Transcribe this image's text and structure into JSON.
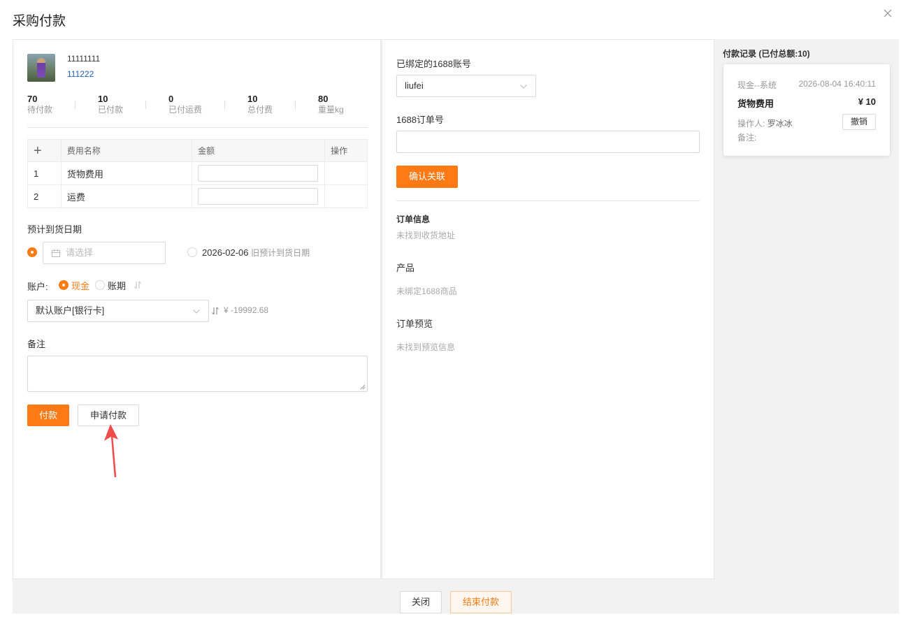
{
  "dialog": {
    "title": "采购付款"
  },
  "product": {
    "code": "11111111",
    "sub": "111222"
  },
  "stats": [
    {
      "value": "70",
      "label": "待付款"
    },
    {
      "value": "10",
      "label": "已付款"
    },
    {
      "value": "0",
      "label": "已付运费"
    },
    {
      "value": "10",
      "label": "总付费"
    },
    {
      "value": "80",
      "label": "重量kg"
    }
  ],
  "fee_table": {
    "headers": [
      "+",
      "费用名称",
      "金额",
      "操作"
    ],
    "rows": [
      {
        "index": "1",
        "name": "货物费用",
        "amount": ""
      },
      {
        "index": "2",
        "name": "运费",
        "amount": ""
      }
    ]
  },
  "arrival": {
    "label": "预计到货日期",
    "placeholder": "请选择",
    "old_date": "2026-02-06",
    "old_date_note": "旧预计到货日期"
  },
  "account": {
    "label": "账户:",
    "opt_cash": "现金",
    "opt_credit": "账期",
    "selected": "默认账户[银行卡]",
    "balance": "¥ -19992.68"
  },
  "remark": {
    "label": "备注",
    "value": ""
  },
  "buttons": {
    "pay": "付款",
    "apply_pay": "申请付款",
    "close": "关闭",
    "finish_pay": "结束付款",
    "confirm_link": "确认关联"
  },
  "alibaba": {
    "account_label": "已绑定的1688账号",
    "account_value": "liufei",
    "order_label": "1688订单号",
    "order_value": "",
    "order_info_title": "订单信息",
    "order_info_text": "未找到收货地址",
    "product_title": "产品",
    "product_text": "未绑定1688商品",
    "preview_title": "订单预览",
    "preview_text": "未找到预览信息"
  },
  "records": {
    "title": "付款记录 (已付总额:10)",
    "items": [
      {
        "source": "现金--系统",
        "time": "2026-08-04 16:40:11",
        "item": "货物费用",
        "amount": "¥ 10",
        "operator_label": "操作人:",
        "operator": "罗冰冰",
        "note_label": "备注:",
        "cancel": "撤销"
      }
    ]
  },
  "colors": {
    "accent": "#ff7a15",
    "link": "#1e5fb4",
    "muted": "#999999"
  },
  "icons": {
    "close": "close-icon",
    "calendar": "calendar-icon",
    "chevron": "chevron-down-icon",
    "swap": "swap-icon",
    "plus": "plus-icon"
  }
}
